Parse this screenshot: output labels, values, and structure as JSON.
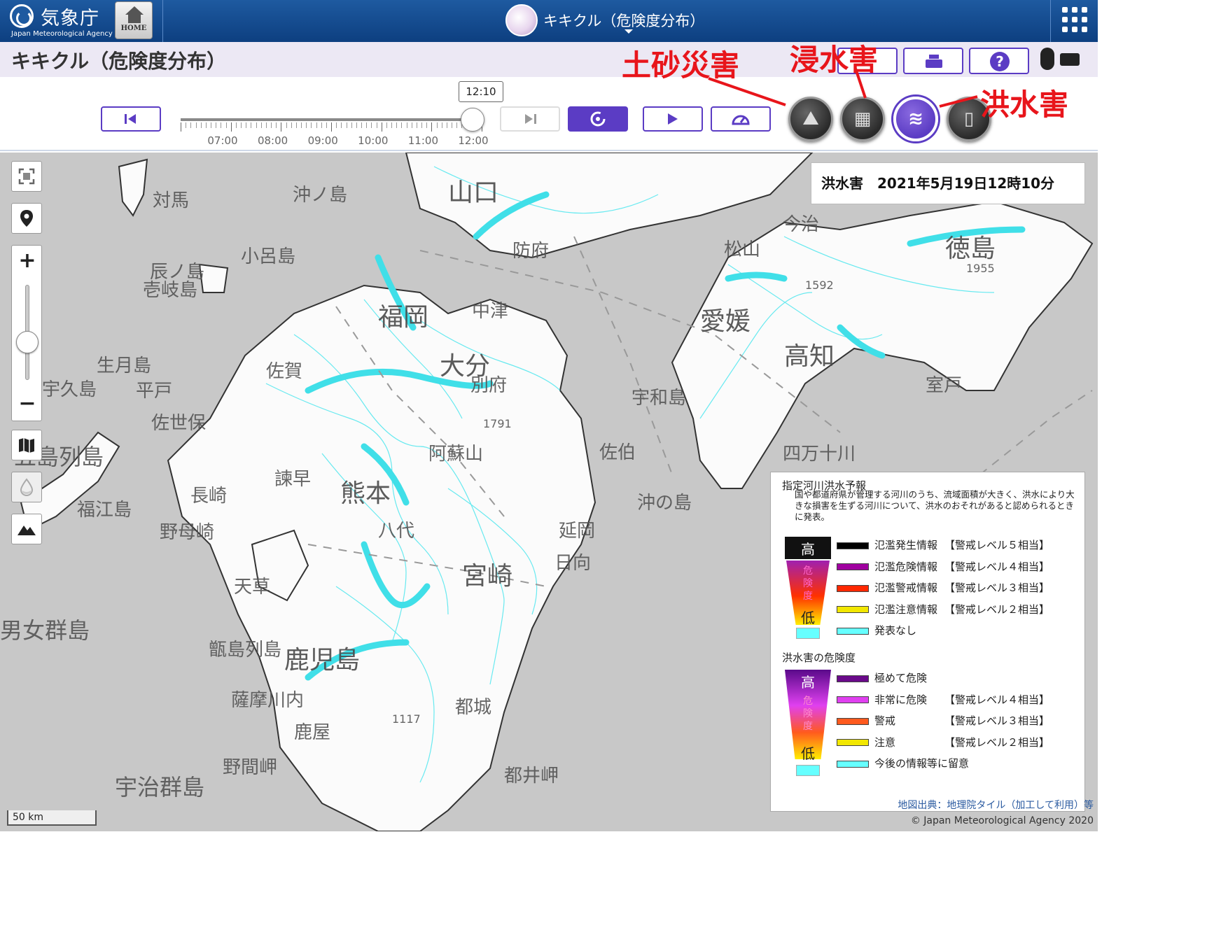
{
  "header": {
    "agency_name": "気象庁",
    "agency_sub": "Japan Meteorological Agency",
    "home_label": "HOME",
    "app_title": "キキクル（危険度分布）"
  },
  "subbar": {
    "page_title": "キキクル（危険度分布）"
  },
  "timeline": {
    "current_time": "12:10",
    "tick_labels": [
      "07:00",
      "08:00",
      "09:00",
      "10:00",
      "11:00",
      "12:00"
    ],
    "position_fraction": 0.97
  },
  "annotations": {
    "sediment": "土砂災害",
    "inundation": "浸水害",
    "flood": "洪水害"
  },
  "map": {
    "info_title": "洪水害　2021年5月19日12時10分",
    "labels": [
      "対馬",
      "沖ノ島",
      "小呂島",
      "辰ノ島",
      "壱岐島",
      "生月島",
      "宇久島",
      "平戸",
      "佐世保",
      "五島列島",
      "長崎",
      "福江島",
      "野母崎",
      "男女群島",
      "天草",
      "甑島列島",
      "宇治群島",
      "鹿児島",
      "薩摩川内",
      "野間岬",
      "山口",
      "防府",
      "中津",
      "大分",
      "別府",
      "阿蘇山",
      "熊本",
      "八代",
      "宮崎",
      "延岡",
      "日向",
      "都城",
      "都井岬",
      "佐伯",
      "沖の島",
      "宇和島",
      "愛媛",
      "高知",
      "室戸",
      "徳島",
      "四万十川",
      "今治",
      "松山",
      "福岡",
      "佐賀",
      "諫早",
      "鹿屋",
      "1955",
      "1791",
      "1592",
      "1117"
    ],
    "scale_label": "50 km",
    "attribution": "地図出典：地理院タイル（加工して利用）等",
    "copyright": "© Japan Meteorological Agency 2020"
  },
  "legend": {
    "section1_title": "指定河川洪水予報",
    "section1_note": "国や都道府県が管理する河川のうち、流域面積が大きく、洪水により大きな損害を生ずる河川について、洪水のおそれがあると認められるときに発表。",
    "scale_high": "高",
    "scale_mid": "危険度",
    "scale_low": "低",
    "section1_items": [
      {
        "label": "氾濫発生情報",
        "level": "【警戒レベル５相当】",
        "color": "#000000"
      },
      {
        "label": "氾濫危険情報",
        "level": "【警戒レベル４相当】",
        "color": "#a000a0"
      },
      {
        "label": "氾濫警戒情報",
        "level": "【警戒レベル３相当】",
        "color": "#ff2800"
      },
      {
        "label": "氾濫注意情報",
        "level": "【警戒レベル２相当】",
        "color": "#f2e700"
      },
      {
        "label": "発表なし",
        "level": "",
        "color": "#66ffff"
      }
    ],
    "section2_title": "洪水害の危険度",
    "section2_items": [
      {
        "label": "極めて危険",
        "level": "",
        "color": "#6a0a8a"
      },
      {
        "label": "非常に危険",
        "level": "【警戒レベル４相当】",
        "color": "#e040f0"
      },
      {
        "label": "警戒",
        "level": "【警戒レベル３相当】",
        "color": "#ff5a1e"
      },
      {
        "label": "注意",
        "level": "【警戒レベル２相当】",
        "color": "#f2e700"
      },
      {
        "label": "今後の情報等に留意",
        "level": "",
        "color": "#66ffff"
      }
    ]
  }
}
